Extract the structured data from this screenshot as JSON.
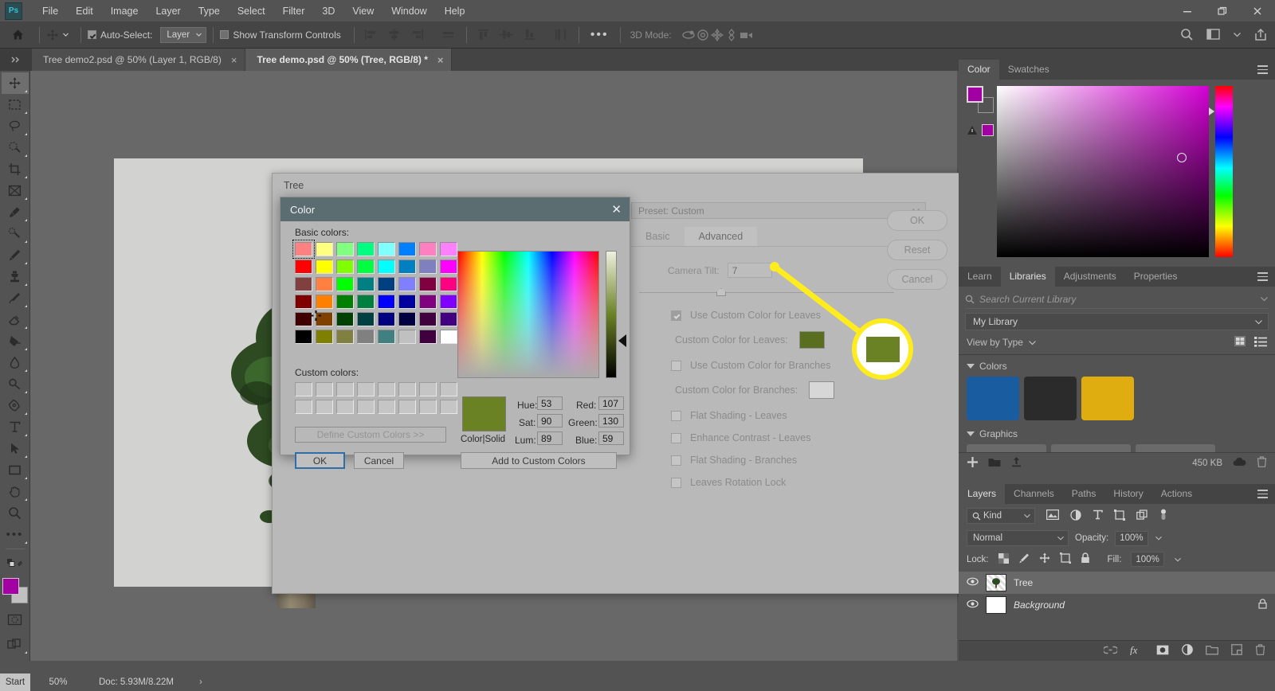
{
  "app": {
    "name": "Ps",
    "menus": [
      "File",
      "Edit",
      "Image",
      "Layer",
      "Type",
      "Select",
      "Filter",
      "3D",
      "View",
      "Window",
      "Help"
    ],
    "window_buttons": [
      "minimize",
      "restore",
      "close"
    ]
  },
  "options_bar": {
    "home_icon": "home-icon",
    "tool_icon": "move-tool-icon",
    "auto_select_label": "Auto-Select:",
    "auto_select_checked": true,
    "layer_dropdown_value": "Layer",
    "show_transform_label": "Show Transform Controls",
    "show_transform_checked": false,
    "align_icons": [
      "align-left-edges",
      "align-horizontal-centers",
      "align-right-edges",
      "distribute-horizontal"
    ],
    "distribute_icons": [
      "align-top-edges",
      "align-vertical-centers",
      "align-bottom-edges",
      "distribute-vertical"
    ],
    "more_icon": "ellipsis-icon",
    "mode_3d_label": "3D Mode:",
    "mode_3d_icons": [
      "orbit-3d-icon",
      "roll-3d-icon",
      "pan-3d-icon",
      "slide-3d-icon",
      "camera-3d-icon"
    ],
    "right_icons": [
      "search-icon",
      "workspace-icon",
      "chevron-down-icon",
      "share-icon"
    ]
  },
  "tabs": [
    {
      "label": "Tree demo2.psd @ 50% (Layer 1, RGB/8)",
      "active": false
    },
    {
      "label": "Tree demo.psd @ 50% (Tree, RGB/8) *",
      "active": true
    }
  ],
  "toolbar": {
    "tools": [
      {
        "name": "move-tool",
        "selected": true
      },
      {
        "name": "rectangular-marquee-tool",
        "selected": false
      },
      {
        "name": "lasso-tool",
        "selected": false
      },
      {
        "name": "quick-selection-tool",
        "selected": false
      },
      {
        "name": "crop-tool",
        "selected": false
      },
      {
        "name": "frame-tool",
        "selected": false
      },
      {
        "name": "eyedropper-tool",
        "selected": false
      },
      {
        "name": "spot-healing-brush-tool",
        "selected": false
      },
      {
        "name": "brush-tool",
        "selected": false
      },
      {
        "name": "clone-stamp-tool",
        "selected": false
      },
      {
        "name": "history-brush-tool",
        "selected": false
      },
      {
        "name": "eraser-tool",
        "selected": false
      },
      {
        "name": "gradient-tool",
        "selected": false
      },
      {
        "name": "blur-tool",
        "selected": false
      },
      {
        "name": "dodge-tool",
        "selected": false
      },
      {
        "name": "pen-tool",
        "selected": false
      },
      {
        "name": "type-tool",
        "selected": false
      },
      {
        "name": "path-selection-tool",
        "selected": false
      },
      {
        "name": "rectangle-tool",
        "selected": false
      },
      {
        "name": "hand-tool",
        "selected": false
      },
      {
        "name": "zoom-tool",
        "selected": false
      },
      {
        "name": "edit-toolbar",
        "selected": false
      }
    ],
    "foreground_color": "#a200a2",
    "background_color": "#c0c0c0",
    "quick_mask_icon": "quick-mask-icon",
    "screen_mode_icon": "screen-mode-icon"
  },
  "tree_dialog": {
    "title": "Tree",
    "preset_label": "Preset: Custom",
    "tabs": [
      {
        "label": "Basic",
        "active": false
      },
      {
        "label": "Advanced",
        "active": true
      }
    ],
    "camera_tilt_label": "Camera Tilt:",
    "camera_tilt_value": "7",
    "options": [
      {
        "label": "Use Custom Color for Leaves",
        "checked": true
      },
      {
        "label": "Use Custom Color for Branches",
        "checked": false
      },
      {
        "label": "Flat Shading - Leaves",
        "checked": false
      },
      {
        "label": "Enhance Contrast - Leaves",
        "checked": false
      },
      {
        "label": "Flat Shading - Branches",
        "checked": false
      },
      {
        "label": "Leaves Rotation Lock",
        "checked": false
      }
    ],
    "leaves_color_label": "Custom Color for Leaves:",
    "leaves_color": "#5a6e20",
    "branches_color_label": "Custom Color for Branches:",
    "branches_color": "#d7d7d7",
    "buttons": [
      "OK",
      "Reset",
      "Cancel"
    ]
  },
  "color_dialog": {
    "title": "Color",
    "close_icon": "close-icon",
    "basic_colors_label": "Basic colors:",
    "custom_colors_label": "Custom colors:",
    "define_custom_label": "Define Custom Colors >>",
    "ok_label": "OK",
    "cancel_label": "Cancel",
    "add_to_custom_label": "Add to Custom Colors",
    "color_solid_label": "Color|Solid",
    "preview_color": "#6b8224",
    "fields": [
      {
        "label": "Hue:",
        "value": "53"
      },
      {
        "label": "Sat:",
        "value": "90"
      },
      {
        "label": "Lum:",
        "value": "89"
      },
      {
        "label": "Red:",
        "value": "107"
      },
      {
        "label": "Green:",
        "value": "130"
      },
      {
        "label": "Blue:",
        "value": "59"
      }
    ],
    "basic_swatches": [
      "#ff8080",
      "#ffff80",
      "#80ff80",
      "#00ff80",
      "#80ffff",
      "#0080ff",
      "#ff80c0",
      "#ff80ff",
      "#ff0000",
      "#ffff00",
      "#80ff00",
      "#00ff40",
      "#00ffff",
      "#0080c0",
      "#8080c0",
      "#ff00ff",
      "#804040",
      "#ff8040",
      "#00ff00",
      "#008080",
      "#004080",
      "#8080ff",
      "#800040",
      "#ff0080",
      "#800000",
      "#ff8000",
      "#008000",
      "#008040",
      "#0000ff",
      "#0000a0",
      "#800080",
      "#8000ff",
      "#400000",
      "#804000",
      "#004000",
      "#004040",
      "#000080",
      "#000040",
      "#400040",
      "#400080",
      "#000000",
      "#808000",
      "#808040",
      "#808080",
      "#408080",
      "#c0c0c0",
      "#400040",
      "#ffffff"
    ],
    "selected_swatch_index": 0,
    "custom_swatch_count": 16
  },
  "color_panel": {
    "tabs": [
      {
        "label": "Color",
        "active": true
      },
      {
        "label": "Swatches",
        "active": false
      }
    ],
    "menu_icon": "panel-menu-icon",
    "foreground_color": "#a200a2",
    "background_color": "#535353",
    "out_of_gamut_icon": "gamut-warning-icon"
  },
  "libraries_panel": {
    "tabs": [
      {
        "label": "Learn",
        "active": false
      },
      {
        "label": "Libraries",
        "active": true
      },
      {
        "label": "Adjustments",
        "active": false
      },
      {
        "label": "Properties",
        "active": false
      }
    ],
    "menu_icon": "panel-menu-icon",
    "search_placeholder": "Search Current Library",
    "search_icon": "search-icon",
    "library_name": "My Library",
    "view_by_label": "View by Type",
    "grid_view_icon": "grid-view-icon",
    "list_view_icon": "list-view-icon",
    "groups": [
      {
        "label": "Colors",
        "chips": [
          "#1a5ca0",
          "#2b2b2b",
          "#e0ad10"
        ]
      },
      {
        "label": "Graphics",
        "chips": [
          "#6a6a6a",
          "#6a6a6a",
          "#6a6a6a"
        ]
      }
    ],
    "footer": {
      "add_icon": "add-icon",
      "folder_icon": "folder-icon",
      "upload_icon": "upload-icon",
      "size_label": "450 KB",
      "cloud_icon": "cloud-icon",
      "delete_icon": "trash-icon"
    }
  },
  "layers_panel": {
    "tabs": [
      {
        "label": "Layers",
        "active": true
      },
      {
        "label": "Channels",
        "active": false
      },
      {
        "label": "Paths",
        "active": false
      },
      {
        "label": "History",
        "active": false
      },
      {
        "label": "Actions",
        "active": false
      }
    ],
    "menu_icon": "panel-menu-icon",
    "filter_label": "Kind",
    "filter_icons": [
      "filter-image-icon",
      "filter-adjustment-icon",
      "filter-type-icon",
      "filter-shape-icon",
      "filter-smart-object-icon",
      "filter-toggle-icon"
    ],
    "blend_mode": "Normal",
    "opacity_label": "Opacity:",
    "opacity_value": "100%",
    "lock_label": "Lock:",
    "lock_icons": [
      "lock-transparent-pixels-icon",
      "lock-image-pixels-icon",
      "lock-position-icon",
      "lock-artboard-icon",
      "lock-all-icon"
    ],
    "fill_label": "Fill:",
    "fill_value": "100%",
    "layers": [
      {
        "name": "Tree",
        "visible": true,
        "selected": true,
        "italic": false,
        "locked": false
      },
      {
        "name": "Background",
        "visible": true,
        "selected": false,
        "italic": true,
        "locked": true
      }
    ],
    "footer_icons": [
      "link-layers-icon",
      "fx-icon",
      "add-mask-icon",
      "new-adjustment-layer-icon",
      "new-group-icon",
      "new-layer-icon",
      "delete-layer-icon"
    ]
  },
  "status_bar": {
    "start_label": "Start",
    "zoom_level": "50%",
    "doc_info": "Doc: 5.93M/8.22M",
    "arrow_icon": "chevron-right-icon"
  },
  "callout": {
    "highlight_color": "#ffec1f",
    "swatch_color": "#6b8224"
  }
}
